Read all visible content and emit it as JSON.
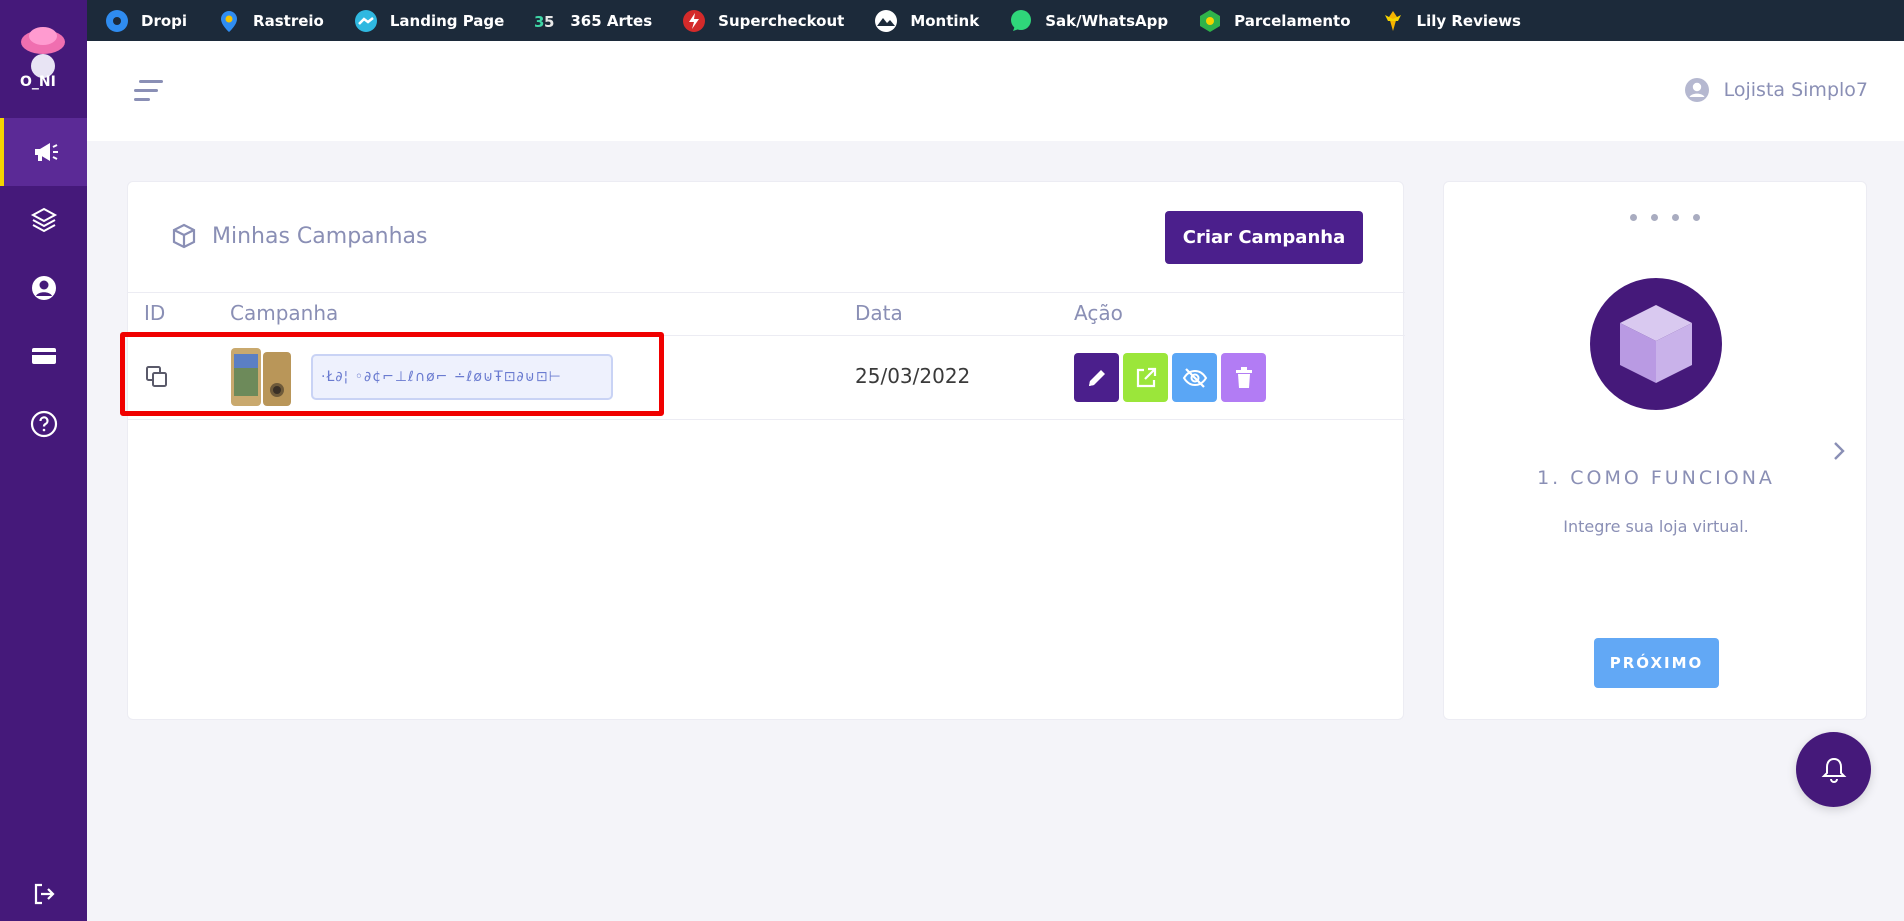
{
  "topbar": {
    "items": [
      {
        "label": "Dropi",
        "icon": "dropi-icon"
      },
      {
        "label": "Rastreio",
        "icon": "rastreio-icon"
      },
      {
        "label": "Landing Page",
        "icon": "landing-page-icon"
      },
      {
        "label": "365 Artes",
        "icon": "365-artes-icon"
      },
      {
        "label": "Supercheckout",
        "icon": "supercheckout-icon"
      },
      {
        "label": "Montink",
        "icon": "montink-icon"
      },
      {
        "label": "Sak/WhatsApp",
        "icon": "whatsapp-icon"
      },
      {
        "label": "Parcelamento",
        "icon": "parcelamento-icon"
      },
      {
        "label": "Lily Reviews",
        "icon": "lily-reviews-icon"
      }
    ]
  },
  "sidebar": {
    "items": [
      {
        "name": "campaigns",
        "icon": "megaphone-icon",
        "active": true
      },
      {
        "name": "layers",
        "icon": "layers-icon",
        "active": false
      },
      {
        "name": "account",
        "icon": "user-circle-icon",
        "active": false
      },
      {
        "name": "billing",
        "icon": "credit-card-icon",
        "active": false
      },
      {
        "name": "help",
        "icon": "question-circle-icon",
        "active": false
      }
    ],
    "logout_icon": "logout-icon"
  },
  "header": {
    "user_name": "Lojista Simplo7"
  },
  "campaigns": {
    "title": "Minhas Campanhas",
    "create_label": "Criar Campanha",
    "columns": {
      "id": "ID",
      "campaign": "Campanha",
      "date": "Data",
      "action": "Ação"
    },
    "rows": [
      {
        "campaign_name": "·Ł∂¦ ◦∂¢⌐⊥ℓ∩ø⌐ ∸ℓø⊍Ŧ⊡∂⊍⊡⊢",
        "date": "25/03/2022"
      }
    ]
  },
  "guide": {
    "step_title": "1. COMO FUNCIONA",
    "step_desc": "Integre sua loja virtual.",
    "next_label": "PRÓXIMO"
  },
  "colors": {
    "sidebar": "#45197a",
    "topbar": "#1c2a3a",
    "primary": "#4b1f8c",
    "edit": "#4b1f8c",
    "open": "#9be63a",
    "hide": "#5aa6f5",
    "delete": "#b27cf4",
    "highlight": "#f00000"
  }
}
